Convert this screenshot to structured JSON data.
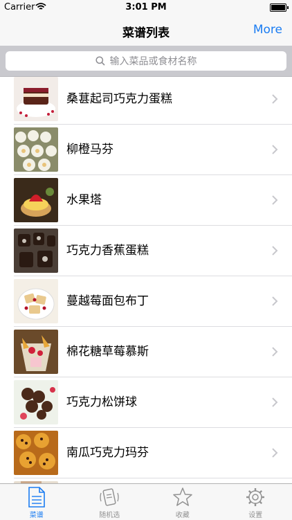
{
  "status": {
    "carrier": "Carrier",
    "time": "3:01 PM"
  },
  "nav": {
    "title": "菜谱列表",
    "more": "More"
  },
  "search": {
    "placeholder": "输入菜品或食材名称"
  },
  "list": {
    "items": [
      {
        "label": "桑葚起司巧克力蛋糕",
        "thumb": "cake-icon"
      },
      {
        "label": "柳橙马芬",
        "thumb": "muffin-icon"
      },
      {
        "label": "水果塔",
        "thumb": "tart-icon"
      },
      {
        "label": "巧克力香蕉蛋糕",
        "thumb": "cake-icon"
      },
      {
        "label": "蔓越莓面包布丁",
        "thumb": "pudding-icon"
      },
      {
        "label": "棉花糖草莓慕斯",
        "thumb": "mousse-icon"
      },
      {
        "label": "巧克力松饼球",
        "thumb": "ball-icon"
      },
      {
        "label": "南瓜巧克力玛芬",
        "thumb": "muffin-icon"
      }
    ]
  },
  "tabbar": {
    "tabs": [
      {
        "label": "菜谱",
        "icon": "document-icon"
      },
      {
        "label": "随机选",
        "icon": "shake-icon"
      },
      {
        "label": "收藏",
        "icon": "star-icon"
      },
      {
        "label": "设置",
        "icon": "gear-icon"
      }
    ],
    "active_index": 0
  },
  "colors": {
    "accent": "#1a7cf2",
    "inactive": "#929292",
    "search_bg": "#c9c9ce"
  }
}
